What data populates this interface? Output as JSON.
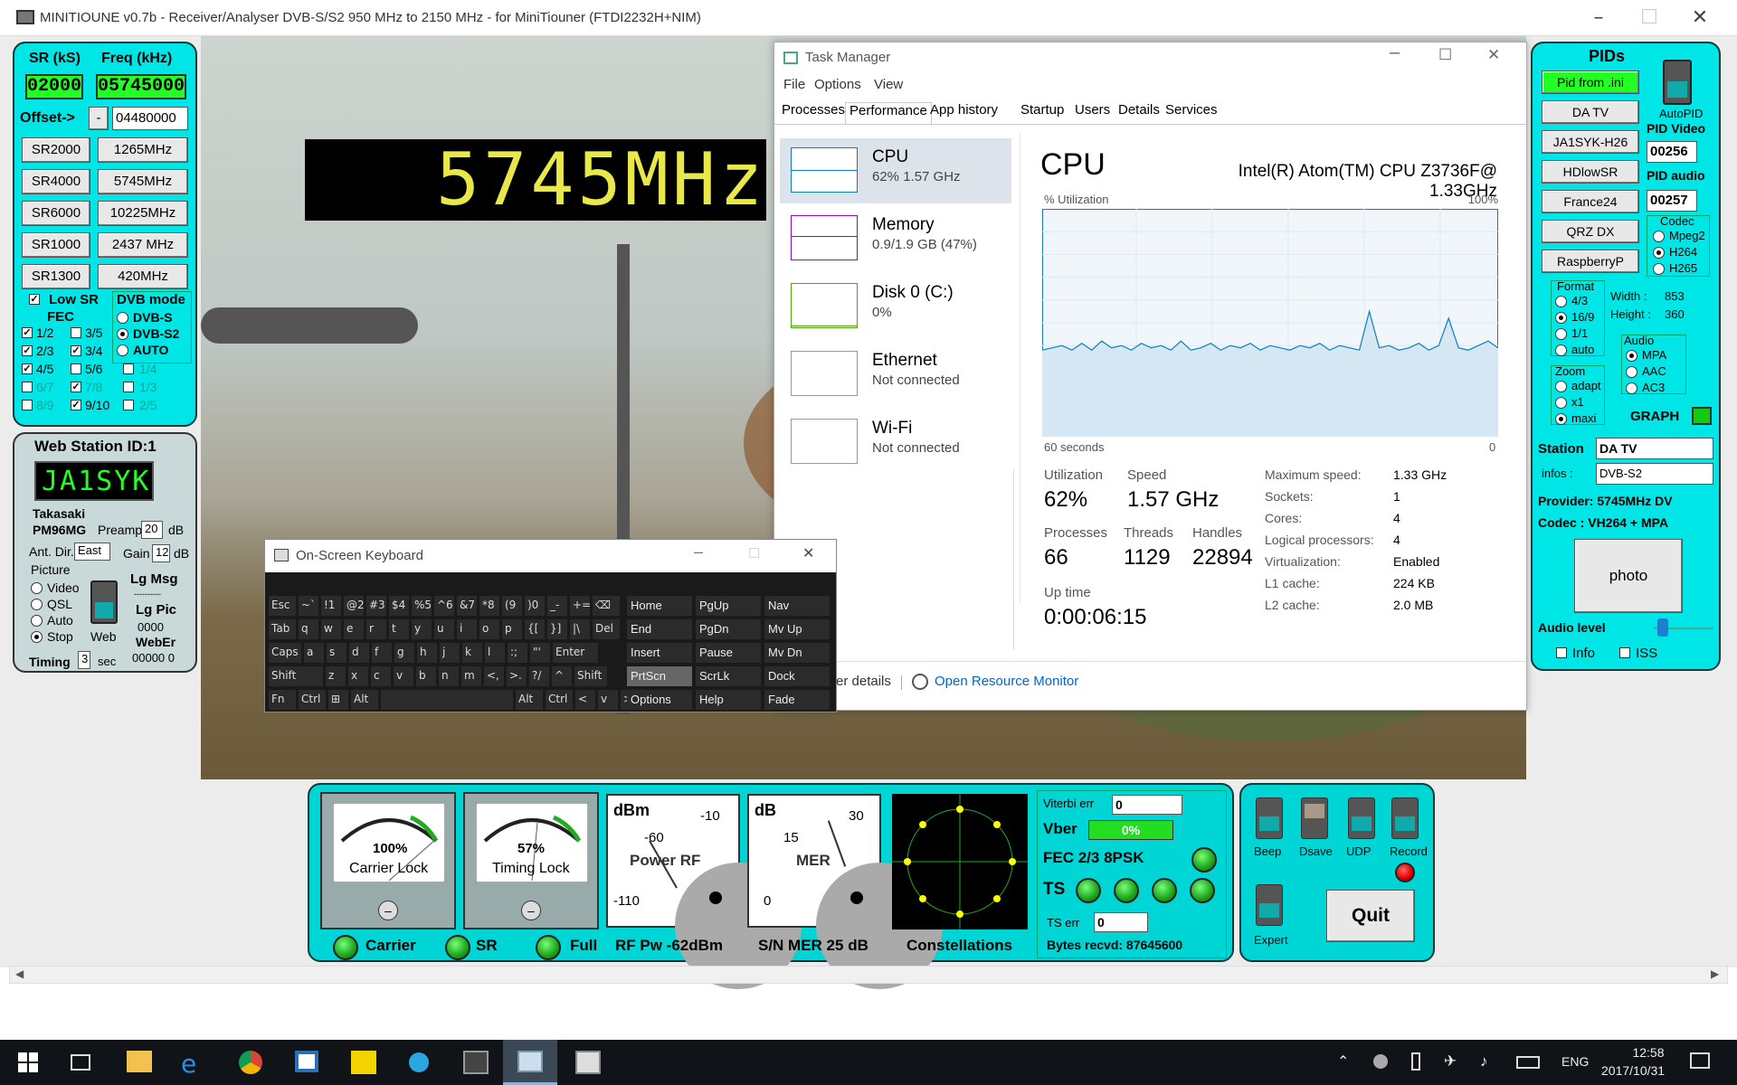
{
  "window": {
    "title": "MINITIOUNE v0.7b - Receiver/Analyser DVB-S/S2 950 MHz to 2150 MHz - for MiniTiouner (FTDI2232H+NIM)"
  },
  "left_panel": {
    "sr_label": "SR (kS)",
    "freq_label": "Freq (kHz)",
    "sr_value": "02000",
    "freq_value": "05745000",
    "offset_label": "Offset->",
    "offset_sign": "-",
    "offset_value": "04480000",
    "sr_buttons": [
      "SR2000",
      "SR4000",
      "SR6000",
      "SR1000",
      "SR1300"
    ],
    "freq_buttons": [
      "1265MHz",
      "5745MHz",
      "10225MHz",
      "2437 MHz",
      "420MHz"
    ],
    "low_sr": "Low SR",
    "fec": "FEC",
    "dvb_mode": "DVB mode",
    "dvb_options": [
      "DVB-S",
      "DVB-S2",
      "AUTO"
    ],
    "fec_rows": [
      [
        "1/2",
        "3/5"
      ],
      [
        "2/3",
        "3/4"
      ],
      [
        "4/5",
        "5/6"
      ],
      [
        "6/7",
        "7/8"
      ],
      [
        "8/9",
        "9/10"
      ]
    ],
    "fec_extra": [
      "1/4",
      "1/3",
      "2/5"
    ]
  },
  "web_panel": {
    "title": "Web Station ID:1",
    "callsign": "JA1SYK",
    "city": "Takasaki",
    "locator": "PM96MG",
    "preamp_label": "Preamp",
    "preamp_value": "20",
    "db": "dB",
    "antdir_label": "Ant. Dir.",
    "antdir_value": "East",
    "gain_label": "Gain",
    "gain_value": "12",
    "picture_label": "Picture",
    "picture_options": [
      "Video",
      "QSL",
      "Auto",
      "Stop"
    ],
    "web_label": "Web",
    "lg_msg": "Lg Msg",
    "dots": "----------",
    "lg_pic": "Lg Pic",
    "lg_pic_value": "0000",
    "weber": "WebEr",
    "weber_value": "00000  0",
    "timing_label": "Timing",
    "timing_value": "3",
    "sec": "sec"
  },
  "video": {
    "freq_banner": "5745MHz"
  },
  "task_manager": {
    "title": "Task Manager",
    "menu": [
      "File",
      "Options",
      "View"
    ],
    "tabs": [
      "Processes",
      "Performance",
      "App history",
      "Startup",
      "Users",
      "Details",
      "Services"
    ],
    "side": [
      {
        "name": "CPU",
        "sub": "62%  1.57 GHz"
      },
      {
        "name": "Memory",
        "sub": "0.9/1.9 GB (47%)"
      },
      {
        "name": "Disk 0 (C:)",
        "sub": "0%"
      },
      {
        "name": "Ethernet",
        "sub": "Not connected"
      },
      {
        "name": "Wi-Fi",
        "sub": "Not connected"
      }
    ],
    "cpu_title": "CPU",
    "cpu_model": "Intel(R) Atom(TM) CPU Z3736F@ 1.33GHz",
    "util_label": "% Utilization",
    "util_max": "100%",
    "time_left": "60 seconds",
    "time_right": "0",
    "stats": {
      "utilization_label": "Utilization",
      "utilization": "62%",
      "speed_label": "Speed",
      "speed": "1.57 GHz",
      "processes_label": "Processes",
      "processes": "66",
      "threads_label": "Threads",
      "threads": "1129",
      "handles_label": "Handles",
      "handles": "22894",
      "uptime_label": "Up time",
      "uptime": "0:00:06:15"
    },
    "specs": [
      [
        "Maximum speed:",
        "1.33 GHz"
      ],
      [
        "Sockets:",
        "1"
      ],
      [
        "Cores:",
        "4"
      ],
      [
        "Logical processors:",
        "4"
      ],
      [
        "Virtualization:",
        "Enabled"
      ],
      [
        "L1 cache:",
        "224 KB"
      ],
      [
        "L2 cache:",
        "2.0 MB"
      ]
    ],
    "fewer": "er details",
    "resmon": "Open Resource Monitor",
    "cpu_graph": [
      38,
      39,
      40,
      38,
      41,
      38,
      42,
      39,
      40,
      38,
      41,
      39,
      40,
      38,
      42,
      38,
      39,
      41,
      38,
      40,
      39,
      41,
      38,
      40,
      39,
      38,
      40,
      39,
      41,
      38,
      40,
      39,
      38,
      55,
      39,
      40,
      38,
      39,
      41,
      38,
      40,
      52,
      39,
      38,
      40,
      42,
      39
    ]
  },
  "osk": {
    "title": "On-Screen Keyboard",
    "rows": [
      [
        "Esc",
        "~`",
        "!1",
        "@2",
        "#3",
        "$4",
        "%5",
        "^6",
        "&7",
        "*8",
        "(9",
        ")0",
        "_-",
        "+=",
        "⌫"
      ],
      [
        "Tab",
        "q",
        "w",
        "e",
        "r",
        "t",
        "y",
        "u",
        "i",
        "o",
        "p",
        "{[",
        "}]",
        "|\\",
        "Del"
      ],
      [
        "Caps",
        "a",
        "s",
        "d",
        "f",
        "g",
        "h",
        "j",
        "k",
        "l",
        ":;",
        "\"'",
        "Enter"
      ],
      [
        "Shift",
        "z",
        "x",
        "c",
        "v",
        "b",
        "n",
        "m",
        "<,",
        ">.",
        "?/",
        "^",
        "Shift"
      ],
      [
        "Fn",
        "Ctrl",
        "⊞",
        "Alt",
        "",
        "Alt",
        "Ctrl",
        "<",
        "v",
        ">",
        "▤"
      ]
    ],
    "nav": [
      [
        "Home",
        "PgUp",
        "Nav"
      ],
      [
        "End",
        "PgDn",
        "Mv Up"
      ],
      [
        "Insert",
        "Pause",
        "Mv Dn"
      ],
      [
        "PrtScn",
        "ScrLk",
        "Dock"
      ],
      [
        "Options",
        "Help",
        "Fade"
      ]
    ]
  },
  "right_panel": {
    "pids": "PIDs",
    "buttons": [
      "Pid from .ini",
      "DA TV",
      "JA1SYK-H26",
      "HDlowSR",
      "France24",
      "QRZ DX",
      "RaspberryP"
    ],
    "autopid": "AutoPID",
    "pid_video": "PID Video",
    "pid_video_value": "00256",
    "pid_audio": "PID audio",
    "pid_audio_value": "00257",
    "codec": "Codec",
    "codec_options": [
      "Mpeg2",
      "H264",
      "H265"
    ],
    "format": "Format",
    "format_options": [
      "4/3",
      "16/9",
      "1/1",
      "auto"
    ],
    "width_label": "Width :",
    "width_value": "853",
    "height_label": "Height :",
    "height_value": "360",
    "audio": "Audio",
    "audio_options": [
      "MPA",
      "AAC",
      "AC3"
    ],
    "zoom": "Zoom",
    "zoom_options": [
      "adapt",
      "x1",
      "maxi"
    ],
    "graph": "GRAPH",
    "station_label": "Station",
    "station_value": "DA TV",
    "infos_label": "infos :",
    "infos_value": "DVB-S2",
    "provider": "Provider:    5745MHz DV",
    "codec_line": "Codec :   VH264 + MPA",
    "photo": "photo",
    "audio_level": "Audio level",
    "info": "Info",
    "iss": "ISS"
  },
  "bottom": {
    "carrier_pct": "100%",
    "carrier_label": "Carrier Lock",
    "timing_pct": "57%",
    "timing_label": "Timing Lock",
    "dbm": "dBm",
    "dbm_ticks": [
      "-60",
      "-10",
      "-110"
    ],
    "power_rf": "Power RF",
    "db": "dB",
    "db_ticks": [
      "15",
      "30",
      "0"
    ],
    "mer": "MER",
    "leds": [
      "Carrier",
      "SR",
      "Full"
    ],
    "rf_pw": "RF Pw  -62dBm",
    "sn_mer": "S/N MER   25 dB",
    "constellations": "Constellations",
    "viterbi_label": "Viterbi err",
    "viterbi_value": "0",
    "vber_label": "Vber",
    "vber_value": "0%",
    "fec_line": "FEC 2/3 8PSK",
    "ts_label": "TS",
    "ts_err_label": "TS err",
    "ts_err_value": "0",
    "bytes": "Bytes recvd:   87645600",
    "toggles": [
      "Beep",
      "Dsave",
      "UDP",
      "Record"
    ],
    "expert": "Expert",
    "quit": "Quit"
  },
  "taskbar": {
    "lang": "ENG",
    "time": "12:58",
    "date": "2017/10/31"
  },
  "colors": {
    "cyan": "#00e5e5",
    "green": "#22ff22",
    "winblue": "#0078d7"
  }
}
